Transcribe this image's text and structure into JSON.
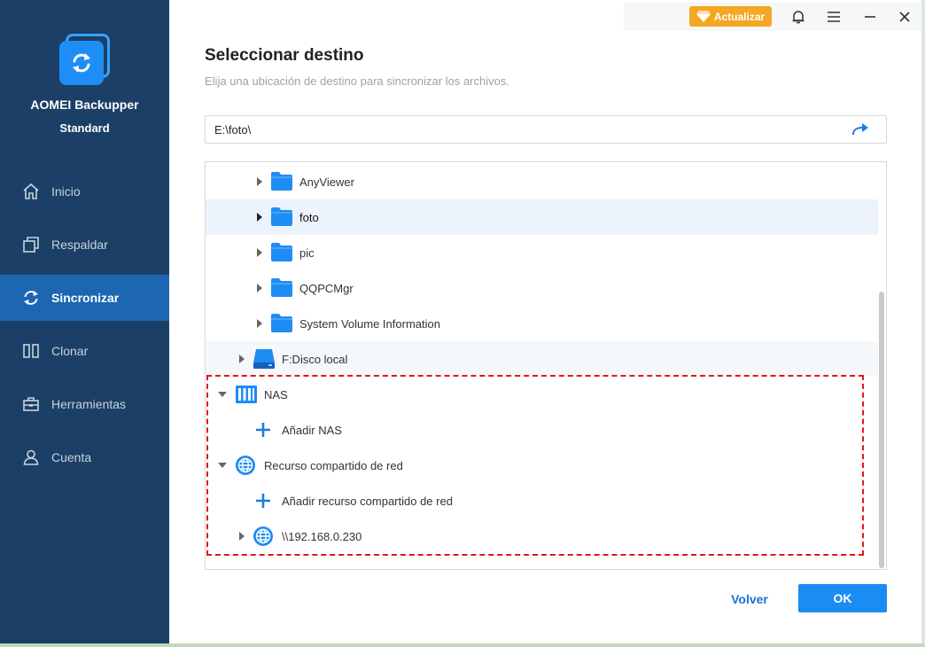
{
  "app": {
    "name_line1": "AOMEI Backupper",
    "name_line2": "Standard"
  },
  "sidebar": {
    "items": [
      {
        "label": "Inicio",
        "icon": "home-icon"
      },
      {
        "label": "Respaldar",
        "icon": "backup-icon"
      },
      {
        "label": "Sincronizar",
        "icon": "sync-icon",
        "active": true
      },
      {
        "label": "Clonar",
        "icon": "clone-icon"
      },
      {
        "label": "Herramientas",
        "icon": "toolbox-icon"
      },
      {
        "label": "Cuenta",
        "icon": "user-icon"
      }
    ]
  },
  "topbar": {
    "upgrade_label": "Actualizar"
  },
  "dialog": {
    "title": "Seleccionar destino",
    "subtitle": "Elija una ubicación de destino para sincronizar los archivos.",
    "path_value": "E:\\foto\\",
    "tree": [
      {
        "label": "AnyViewer",
        "icon": "folder-icon",
        "expanded": false
      },
      {
        "label": "foto",
        "icon": "folder-icon",
        "expanded": false,
        "selected": true
      },
      {
        "label": "pic",
        "icon": "folder-icon",
        "expanded": false
      },
      {
        "label": "QQPCMgr",
        "icon": "folder-icon",
        "expanded": false
      },
      {
        "label": "System Volume Information",
        "icon": "folder-icon",
        "expanded": false
      },
      {
        "label": "F:Disco local",
        "icon": "disk-icon",
        "expanded": false
      },
      {
        "label": "NAS",
        "icon": "nas-icon",
        "expanded": true
      },
      {
        "label": "Añadir NAS",
        "icon": "plus-icon"
      },
      {
        "label": "Recurso compartido de red",
        "icon": "globe-icon",
        "expanded": true
      },
      {
        "label": "Añadir recurso compartido de red",
        "icon": "plus-icon"
      },
      {
        "label": "\\\\192.168.0.230",
        "icon": "globe-icon",
        "expanded": false
      }
    ],
    "back_label": "Volver",
    "ok_label": "OK"
  },
  "colors": {
    "sidebar_bg": "#1b3f66",
    "sidebar_active": "#1c66b2",
    "accent": "#1a8cf3",
    "upgrade": "#f5a623",
    "highlight": "#e3161b"
  }
}
